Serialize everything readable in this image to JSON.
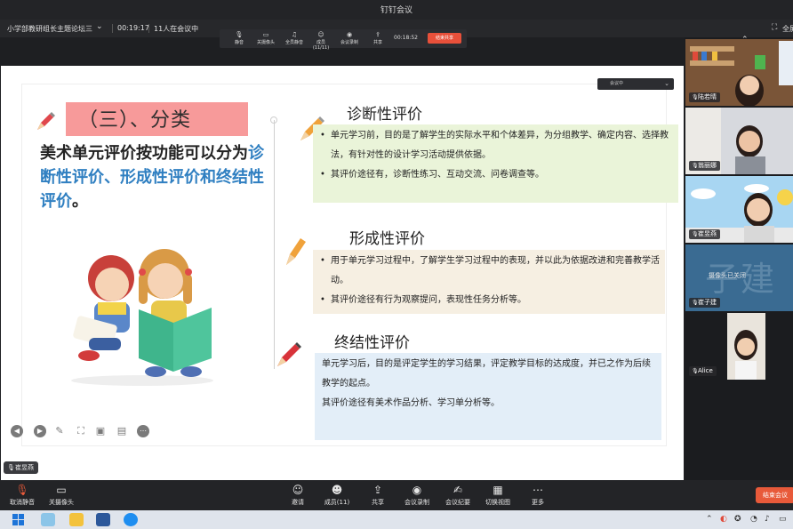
{
  "window": {
    "app_title": "钉钉会议"
  },
  "meeting": {
    "title": "小学部教研组长主题论坛三",
    "duration": "00:19:17",
    "attendees_text": "11人在会议中",
    "layout_label": "全屏"
  },
  "share_toolbar": {
    "items": [
      {
        "label": "静音",
        "icon": "mic-icon"
      },
      {
        "label": "关摄像头",
        "icon": "camera-icon"
      },
      {
        "label": "全员静音",
        "icon": "mute-all-icon"
      },
      {
        "label": "成员(11/11)",
        "icon": "members-icon"
      },
      {
        "label": "会议录制",
        "icon": "record-icon"
      },
      {
        "label": "共享",
        "icon": "share-icon"
      }
    ],
    "timer": "00:18:52",
    "stop_label": "结束共享"
  },
  "camera_select": {
    "label": "会议中"
  },
  "slide": {
    "heading": "（三）、分类",
    "desc_plain_1": "美术单元评价按功能可以分为",
    "desc_highlight": "诊断性评价、形成性评价和终结性评价",
    "desc_plain_2": "。",
    "sections": [
      {
        "title": "诊断性评价",
        "items": [
          "单元学习前，目的是了解学生的实际水平和个体差异，为分组教学、确定内容、选择教法，有针对性的设计学习活动提供依据。",
          "其评价途径有，诊断性练习、互动交流、问卷调查等。"
        ]
      },
      {
        "title": "形成性评价",
        "items": [
          "用于单元学习过程中，了解学生学习过程中的表现，并以此为依据改进和完善教学活动。",
          "其评价途径有行为观察提问，表现性任务分析等。"
        ]
      },
      {
        "title": "终结性评价",
        "items": [
          "单元学习后，目的是评定学生的学习结果，评定教学目标的达成度，并已之作为后续教学的起点。",
          "其评价途径有美术作品分析、学习单分析等。"
        ]
      }
    ]
  },
  "speaker": {
    "name": "崔昱燕"
  },
  "participants": [
    {
      "name": "陆若晴",
      "camera": "on"
    },
    {
      "name": "翁丽娜",
      "camera": "on"
    },
    {
      "name": "崔昱燕",
      "camera": "on"
    },
    {
      "name": "崔子建",
      "camera": "off",
      "big_name": "子建",
      "camera_off_text": "摄像头已关闭"
    },
    {
      "name": "Alice",
      "camera": "on"
    }
  ],
  "toolbar": {
    "mute": "取消静音",
    "camera": "关摄像头",
    "invite": "邀请",
    "members": "成员(11)",
    "share": "共享",
    "record": "会议录制",
    "minutes": "会议纪要",
    "switch_view": "切换视图",
    "more": "更多",
    "leave": "结束会议"
  },
  "colors": {
    "heading_bg": "#f79a9a",
    "highlight_text": "#2f7fc1",
    "box_green": "#eaf4d9",
    "box_beige": "#f6efe2",
    "box_blue": "#e3eef8",
    "leave_button": "#e85a3a"
  }
}
